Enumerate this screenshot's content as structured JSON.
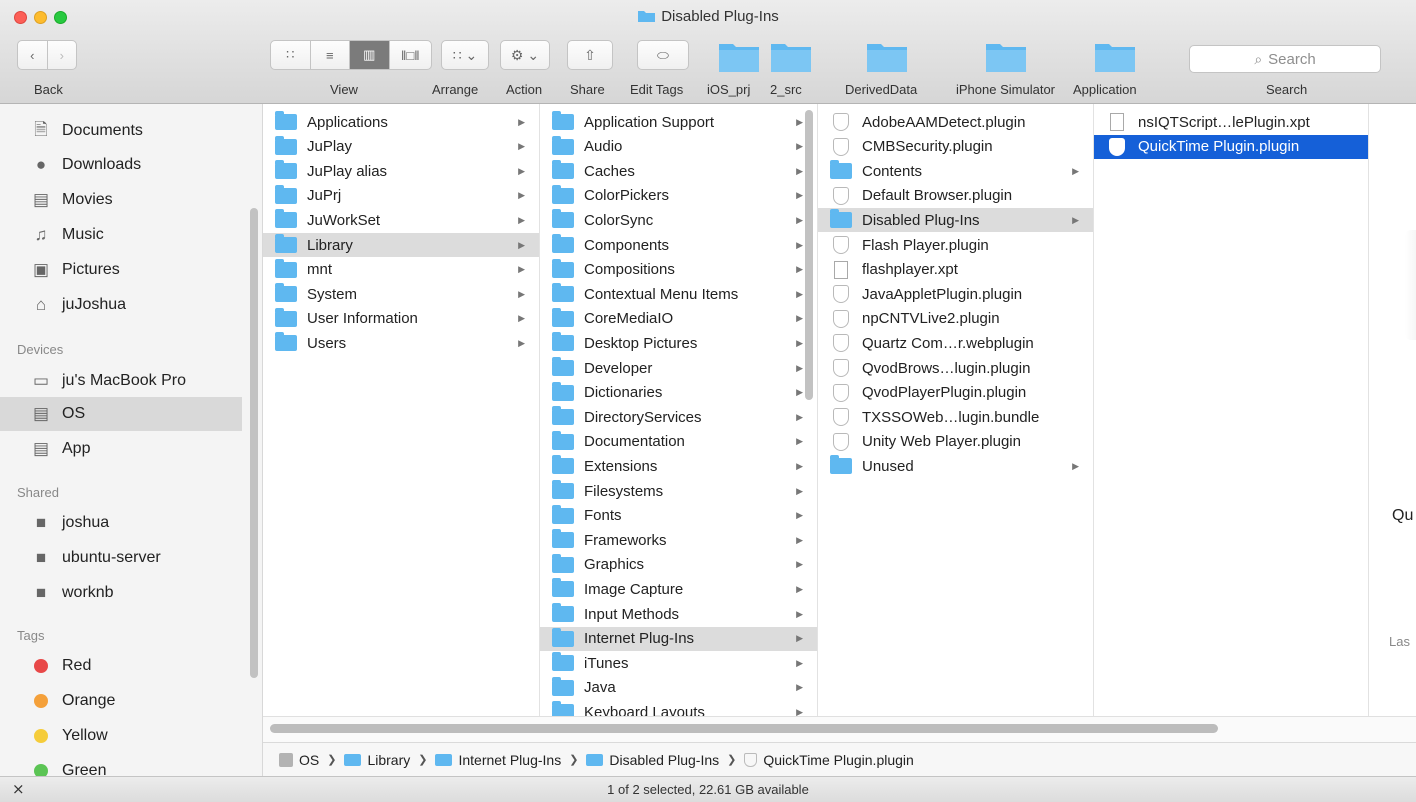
{
  "window": {
    "title": "Disabled Plug-Ins",
    "status": "1 of 2 selected, 22.61 GB available"
  },
  "toolbar": {
    "back_label": "Back",
    "view_label": "View",
    "arrange_label": "Arrange",
    "action_label": "Action",
    "share_label": "Share",
    "edit_tags_label": "Edit Tags",
    "favorites": [
      "iOS_prj",
      "2_src",
      "DerivedData",
      "iPhone Simulator",
      "Application"
    ],
    "search_placeholder": "Search",
    "search_label": "Search"
  },
  "sidebar": {
    "favorites": [
      {
        "label": "Documents",
        "icon": "documents-icon"
      },
      {
        "label": "Downloads",
        "icon": "downloads-icon"
      },
      {
        "label": "Movies",
        "icon": "movies-icon"
      },
      {
        "label": "Music",
        "icon": "music-icon"
      },
      {
        "label": "Pictures",
        "icon": "pictures-icon"
      },
      {
        "label": "juJoshua",
        "icon": "home-icon"
      }
    ],
    "devices_header": "Devices",
    "devices": [
      {
        "label": "ju's MacBook Pro",
        "icon": "laptop-icon"
      },
      {
        "label": "OS",
        "icon": "disk-icon",
        "selected": true
      },
      {
        "label": "App",
        "icon": "disk-icon"
      }
    ],
    "shared_header": "Shared",
    "shared": [
      {
        "label": "joshua",
        "icon": "computer-icon"
      },
      {
        "label": "ubuntu-server",
        "icon": "computer-icon"
      },
      {
        "label": "worknb",
        "icon": "computer-icon"
      }
    ],
    "tags_header": "Tags",
    "tags": [
      {
        "label": "Red",
        "color": "#e84848"
      },
      {
        "label": "Orange",
        "color": "#f4a03a"
      },
      {
        "label": "Yellow",
        "color": "#f5cc3a"
      },
      {
        "label": "Green",
        "color": "#5bc454"
      }
    ]
  },
  "columns": {
    "col1": [
      "Applications",
      "JuPlay",
      "JuPlay alias",
      "JuPrj",
      "JuWorkSet",
      "Library",
      "mnt",
      "System",
      "User Information",
      "Users"
    ],
    "col2": [
      "Application Support",
      "Audio",
      "Caches",
      "ColorPickers",
      "ColorSync",
      "Components",
      "Compositions",
      "Contextual Menu Items",
      "CoreMediaIO",
      "Desktop Pictures",
      "Developer",
      "Dictionaries",
      "DirectoryServices",
      "Documentation",
      "Extensions",
      "Filesystems",
      "Fonts",
      "Frameworks",
      "Graphics",
      "Image Capture",
      "Input Methods",
      "Internet Plug-Ins",
      "iTunes",
      "Java",
      "Keyboard Layouts"
    ],
    "col3": [
      "AdobeAAMDetect.plugin",
      "CMBSecurity.plugin",
      "Contents",
      "Default Browser.plugin",
      "Disabled Plug-Ins",
      "Flash Player.plugin",
      "flashplayer.xpt",
      "JavaAppletPlugin.plugin",
      "npCNTVLive2.plugin",
      "Quartz Com…r.webplugin",
      "QvodBrows…lugin.plugin",
      "QvodPlayerPlugin.plugin",
      "TXSSOWeb…lugin.bundle",
      "Unity Web Player.plugin",
      "Unused"
    ],
    "col4": [
      "nsIQTScript…lePlugin.xpt",
      "QuickTime Plugin.plugin"
    ]
  },
  "pathbar": [
    "OS",
    "Library",
    "Internet Plug-Ins",
    "Disabled Plug-Ins",
    "QuickTime Plugin.plugin"
  ],
  "preview": {
    "name_fragment": "Qu",
    "last_fragment": "Las"
  }
}
